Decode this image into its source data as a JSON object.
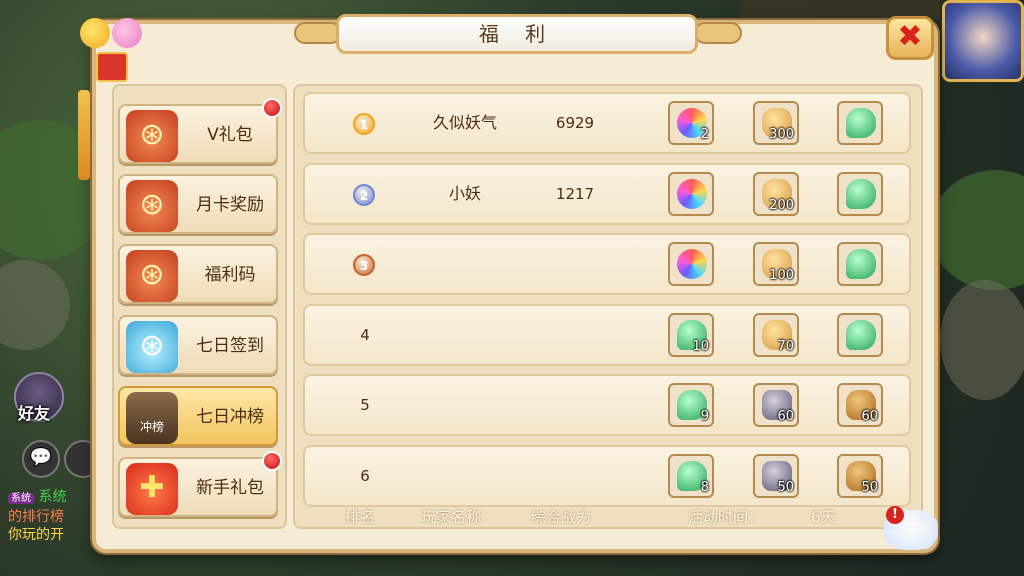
{
  "window": {
    "title": "福 利",
    "close_symbol": "✖"
  },
  "background_hud": {
    "friend_label": "好友",
    "chat_icon": "💬",
    "log_tag": "系统",
    "log_lines": [
      "系统",
      "的排行榜",
      "你玩的开"
    ]
  },
  "tabs": [
    {
      "label": "V礼包",
      "icon": "red-lucky-bag-icon",
      "badge": true,
      "selected": false
    },
    {
      "label": "月卡奖励",
      "icon": "red-lucky-bag-icon",
      "badge": false,
      "selected": false
    },
    {
      "label": "福利码",
      "icon": "red-lucky-bag-icon",
      "badge": false,
      "selected": false
    },
    {
      "label": "七日签到",
      "icon": "blue-lucky-bag-icon",
      "badge": false,
      "selected": false
    },
    {
      "label": "七日冲榜",
      "icon": "rank-chest-icon",
      "icon_text": "冲榜",
      "badge": false,
      "selected": true
    },
    {
      "label": "新手礼包",
      "icon": "gift-box-icon",
      "badge": true,
      "selected": false
    }
  ],
  "ranking": {
    "rows": [
      {
        "rank": "1",
        "name": "久似妖气",
        "power": "6929",
        "rewards": [
          {
            "item": "rainbow-gem",
            "qty": "2"
          },
          {
            "item": "gold-coin",
            "qty": "300"
          },
          {
            "item": "jade",
            "qty": ""
          }
        ]
      },
      {
        "rank": "2",
        "name": "小妖",
        "power": "1217",
        "rewards": [
          {
            "item": "rainbow-gem",
            "qty": ""
          },
          {
            "item": "gold-coin",
            "qty": "200"
          },
          {
            "item": "jade",
            "qty": ""
          }
        ]
      },
      {
        "rank": "3",
        "name": "",
        "power": "",
        "rewards": [
          {
            "item": "rainbow-gem",
            "qty": ""
          },
          {
            "item": "gold-coin",
            "qty": "100"
          },
          {
            "item": "jade",
            "qty": ""
          }
        ]
      },
      {
        "rank": "4",
        "name": "",
        "power": "",
        "rewards": [
          {
            "item": "jade",
            "qty": "10"
          },
          {
            "item": "gold-coin",
            "qty": "70"
          },
          {
            "item": "jade",
            "qty": ""
          }
        ]
      },
      {
        "rank": "5",
        "name": "",
        "power": "",
        "rewards": [
          {
            "item": "jade",
            "qty": "9"
          },
          {
            "item": "stone",
            "qty": "60"
          },
          {
            "item": "pot",
            "qty": "60"
          }
        ]
      },
      {
        "rank": "6",
        "name": "",
        "power": "",
        "rewards": [
          {
            "item": "jade",
            "qty": "8"
          },
          {
            "item": "stone",
            "qty": "50"
          },
          {
            "item": "pot",
            "qty": "50"
          }
        ]
      }
    ],
    "badge_colors": {
      "1": "#f0a51a",
      "2": "#6f86d9",
      "3": "#c8642a"
    }
  },
  "footer": {
    "col_rank": "排名",
    "col_name": "玩家名称",
    "col_power": "综合战力",
    "time_label": "活动时间：",
    "time_value": "6天",
    "alert": "!"
  }
}
